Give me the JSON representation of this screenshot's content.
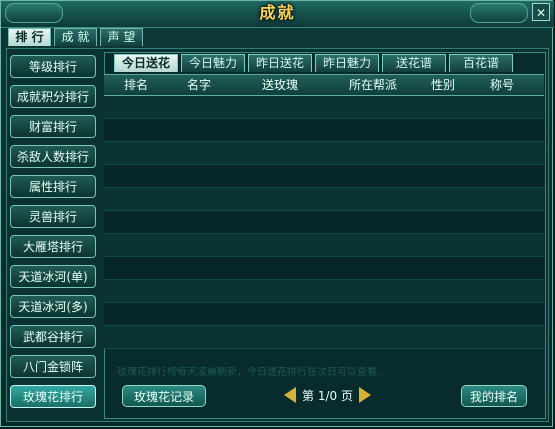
{
  "window": {
    "title": "成就",
    "close_icon": "✕"
  },
  "top_tabs": [
    {
      "label": "排 行",
      "active": true
    },
    {
      "label": "成 就",
      "active": false
    },
    {
      "label": "声 望",
      "active": false
    }
  ],
  "sidebar": {
    "items": [
      {
        "label": "等级排行",
        "active": false
      },
      {
        "label": "成就积分排行",
        "active": false
      },
      {
        "label": "财富排行",
        "active": false
      },
      {
        "label": "杀敌人数排行",
        "active": false
      },
      {
        "label": "属性排行",
        "active": false
      },
      {
        "label": "灵兽排行",
        "active": false
      },
      {
        "label": "大雁塔排行",
        "active": false
      },
      {
        "label": "天道冰河(单)",
        "active": false
      },
      {
        "label": "天道冰河(多)",
        "active": false
      },
      {
        "label": "武都谷排行",
        "active": false
      },
      {
        "label": "八门金锁阵",
        "active": false
      },
      {
        "label": "玫瑰花排行",
        "active": true
      }
    ]
  },
  "ranking_tabs": [
    {
      "label": "今日送花",
      "active": true
    },
    {
      "label": "今日魅力",
      "active": false
    },
    {
      "label": "昨日送花",
      "active": false
    },
    {
      "label": "昨日魅力",
      "active": false
    },
    {
      "label": "送花谱",
      "active": false
    },
    {
      "label": "百花谱",
      "active": false
    }
  ],
  "table": {
    "headers": [
      "排名",
      "名字",
      "送玫瑰",
      "所在帮派",
      "性别",
      "称号"
    ],
    "rows": []
  },
  "footer": {
    "rose_record_label": "玫瑰花记录",
    "page_text": "第 1/0 页",
    "my_rank_label": "我的排名",
    "hint_text": "玫瑰花排行榜每天凌晨刷新，今日送花排行在次日可以查看…"
  },
  "icons": {
    "prev_page": "left-arrow",
    "next_page": "right-arrow"
  }
}
